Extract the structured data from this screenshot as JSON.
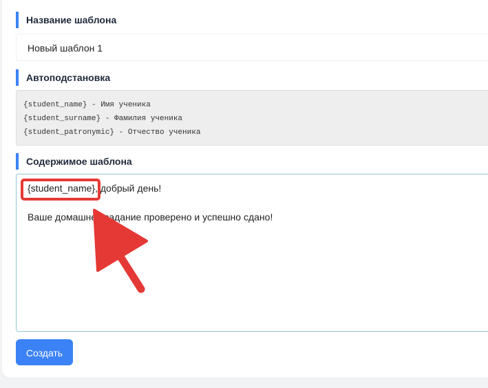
{
  "template_name": {
    "label": "Название шаблона",
    "value": "Новый шаблон 1"
  },
  "autosubstitution": {
    "label": "Автоподстановка",
    "lines": [
      "{student_name} - Имя ученика",
      "{student_surname} - Фамилия ученика",
      "{student_patronymic} - Отчество ученика"
    ]
  },
  "content": {
    "label": "Содержимое шаблона",
    "lines": [
      "{student_name}, добрый день!",
      "Ваше домашнее задание проверено и успешно сдано!"
    ]
  },
  "create_button": {
    "label": "Создать"
  },
  "colors": {
    "accent": "#3b82f6",
    "annotation_red": "#e53935"
  },
  "annotation": {
    "type": "arrow-and-highlight",
    "target": "{student_name}"
  }
}
